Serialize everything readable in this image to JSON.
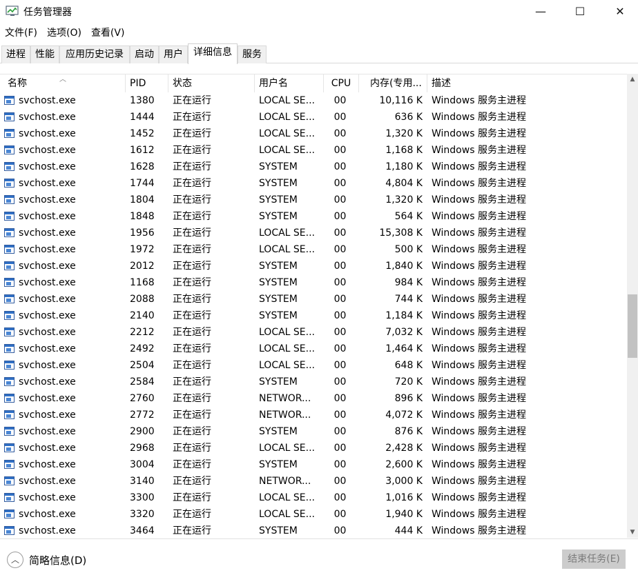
{
  "window": {
    "title": "任务管理器",
    "minimize": "—",
    "maximize": "☐",
    "close": "✕"
  },
  "menu": [
    "文件(F)",
    "选项(O)",
    "查看(V)"
  ],
  "tabs": [
    "进程",
    "性能",
    "应用历史记录",
    "启动",
    "用户",
    "详细信息",
    "服务"
  ],
  "active_tab": "详细信息",
  "columns": [
    "名称",
    "PID",
    "状态",
    "用户名",
    "CPU",
    "内存(专用...",
    "描述"
  ],
  "rows": [
    {
      "name": "svchost.exe",
      "pid": "1380",
      "status": "正在运行",
      "user": "LOCAL SE...",
      "cpu": "00",
      "mem": "10,116 K",
      "desc": "Windows 服务主进程"
    },
    {
      "name": "svchost.exe",
      "pid": "1444",
      "status": "正在运行",
      "user": "LOCAL SE...",
      "cpu": "00",
      "mem": "636 K",
      "desc": "Windows 服务主进程"
    },
    {
      "name": "svchost.exe",
      "pid": "1452",
      "status": "正在运行",
      "user": "LOCAL SE...",
      "cpu": "00",
      "mem": "1,320 K",
      "desc": "Windows 服务主进程"
    },
    {
      "name": "svchost.exe",
      "pid": "1612",
      "status": "正在运行",
      "user": "LOCAL SE...",
      "cpu": "00",
      "mem": "1,168 K",
      "desc": "Windows 服务主进程"
    },
    {
      "name": "svchost.exe",
      "pid": "1628",
      "status": "正在运行",
      "user": "SYSTEM",
      "cpu": "00",
      "mem": "1,180 K",
      "desc": "Windows 服务主进程"
    },
    {
      "name": "svchost.exe",
      "pid": "1744",
      "status": "正在运行",
      "user": "SYSTEM",
      "cpu": "00",
      "mem": "4,804 K",
      "desc": "Windows 服务主进程"
    },
    {
      "name": "svchost.exe",
      "pid": "1804",
      "status": "正在运行",
      "user": "SYSTEM",
      "cpu": "00",
      "mem": "1,320 K",
      "desc": "Windows 服务主进程"
    },
    {
      "name": "svchost.exe",
      "pid": "1848",
      "status": "正在运行",
      "user": "SYSTEM",
      "cpu": "00",
      "mem": "564 K",
      "desc": "Windows 服务主进程"
    },
    {
      "name": "svchost.exe",
      "pid": "1956",
      "status": "正在运行",
      "user": "LOCAL SE...",
      "cpu": "00",
      "mem": "15,308 K",
      "desc": "Windows 服务主进程"
    },
    {
      "name": "svchost.exe",
      "pid": "1972",
      "status": "正在运行",
      "user": "LOCAL SE...",
      "cpu": "00",
      "mem": "500 K",
      "desc": "Windows 服务主进程"
    },
    {
      "name": "svchost.exe",
      "pid": "2012",
      "status": "正在运行",
      "user": "SYSTEM",
      "cpu": "00",
      "mem": "1,840 K",
      "desc": "Windows 服务主进程"
    },
    {
      "name": "svchost.exe",
      "pid": "1168",
      "status": "正在运行",
      "user": "SYSTEM",
      "cpu": "00",
      "mem": "984 K",
      "desc": "Windows 服务主进程"
    },
    {
      "name": "svchost.exe",
      "pid": "2088",
      "status": "正在运行",
      "user": "SYSTEM",
      "cpu": "00",
      "mem": "744 K",
      "desc": "Windows 服务主进程"
    },
    {
      "name": "svchost.exe",
      "pid": "2140",
      "status": "正在运行",
      "user": "SYSTEM",
      "cpu": "00",
      "mem": "1,184 K",
      "desc": "Windows 服务主进程"
    },
    {
      "name": "svchost.exe",
      "pid": "2212",
      "status": "正在运行",
      "user": "LOCAL SE...",
      "cpu": "00",
      "mem": "7,032 K",
      "desc": "Windows 服务主进程"
    },
    {
      "name": "svchost.exe",
      "pid": "2492",
      "status": "正在运行",
      "user": "LOCAL SE...",
      "cpu": "00",
      "mem": "1,464 K",
      "desc": "Windows 服务主进程"
    },
    {
      "name": "svchost.exe",
      "pid": "2504",
      "status": "正在运行",
      "user": "LOCAL SE...",
      "cpu": "00",
      "mem": "648 K",
      "desc": "Windows 服务主进程"
    },
    {
      "name": "svchost.exe",
      "pid": "2584",
      "status": "正在运行",
      "user": "SYSTEM",
      "cpu": "00",
      "mem": "720 K",
      "desc": "Windows 服务主进程"
    },
    {
      "name": "svchost.exe",
      "pid": "2760",
      "status": "正在运行",
      "user": "NETWOR...",
      "cpu": "00",
      "mem": "896 K",
      "desc": "Windows 服务主进程"
    },
    {
      "name": "svchost.exe",
      "pid": "2772",
      "status": "正在运行",
      "user": "NETWOR...",
      "cpu": "00",
      "mem": "4,072 K",
      "desc": "Windows 服务主进程"
    },
    {
      "name": "svchost.exe",
      "pid": "2900",
      "status": "正在运行",
      "user": "SYSTEM",
      "cpu": "00",
      "mem": "876 K",
      "desc": "Windows 服务主进程"
    },
    {
      "name": "svchost.exe",
      "pid": "2968",
      "status": "正在运行",
      "user": "LOCAL SE...",
      "cpu": "00",
      "mem": "2,428 K",
      "desc": "Windows 服务主进程"
    },
    {
      "name": "svchost.exe",
      "pid": "3004",
      "status": "正在运行",
      "user": "SYSTEM",
      "cpu": "00",
      "mem": "2,600 K",
      "desc": "Windows 服务主进程"
    },
    {
      "name": "svchost.exe",
      "pid": "3140",
      "status": "正在运行",
      "user": "NETWOR...",
      "cpu": "00",
      "mem": "3,000 K",
      "desc": "Windows 服务主进程"
    },
    {
      "name": "svchost.exe",
      "pid": "3300",
      "status": "正在运行",
      "user": "LOCAL SE...",
      "cpu": "00",
      "mem": "1,016 K",
      "desc": "Windows 服务主进程"
    },
    {
      "name": "svchost.exe",
      "pid": "3320",
      "status": "正在运行",
      "user": "LOCAL SE...",
      "cpu": "00",
      "mem": "1,940 K",
      "desc": "Windows 服务主进程"
    },
    {
      "name": "svchost.exe",
      "pid": "3464",
      "status": "正在运行",
      "user": "SYSTEM",
      "cpu": "00",
      "mem": "444 K",
      "desc": "Windows 服务主进程"
    }
  ],
  "footer": {
    "fewer_details": "简略信息(D)",
    "end_task": "结束任务(E)"
  },
  "icons": {
    "app": "task-manager-icon",
    "process": "exe-window-icon",
    "collapse": "chevron-up-icon"
  }
}
